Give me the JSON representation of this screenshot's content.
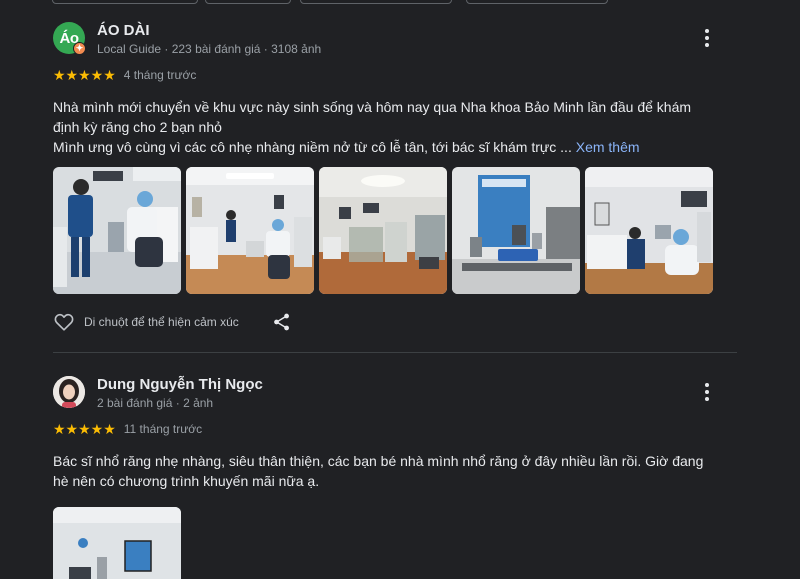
{
  "reviews": [
    {
      "author": "ÁO DÀI",
      "avatar_text": "Áo",
      "meta": "Local Guide · 223 bài đánh giá · 3108 ảnh",
      "stars": "★★★★★",
      "rating": 5,
      "time": "4 tháng trước",
      "lines": [
        "Nhà mình mới chuyển về khu vực này sinh sống và hôm nay qua Nha khoa Bảo Minh lần đầu để khám",
        "định kỳ răng cho 2 bạn nhỏ",
        "Mình ưng vô cùng vì các cô nhẹ nhàng niềm nở từ cô lễ tân, tới bác sĩ khám trực ..."
      ],
      "see_more": "Xem thêm",
      "like_label": "Di chuột để thể hiện cảm xúc",
      "photo_count": 5
    },
    {
      "author": "Dung Nguyễn Thị Ngọc",
      "meta": "2 bài đánh giá · 2 ảnh",
      "stars": "★★★★★",
      "rating": 5,
      "time": "11 tháng trước",
      "lines": [
        "Bác sĩ nhổ răng nhẹ nhàng, siêu thân thiện, các bạn bé nhà mình nhổ răng ở đây nhiều lần rồi. Giờ đang",
        "hè nên có chương trình khuyến mãi nữa ạ."
      ],
      "photo_count": 1
    }
  ],
  "icons": {
    "more": "more-vertical-icon",
    "like": "heart-icon",
    "share": "share-icon",
    "star": "star-icon"
  },
  "colors": {
    "background": "#202124",
    "star": "#fbbc04",
    "link": "#8ab4f8",
    "avatar": "#34a853",
    "guide_badge": "#f28b50"
  }
}
